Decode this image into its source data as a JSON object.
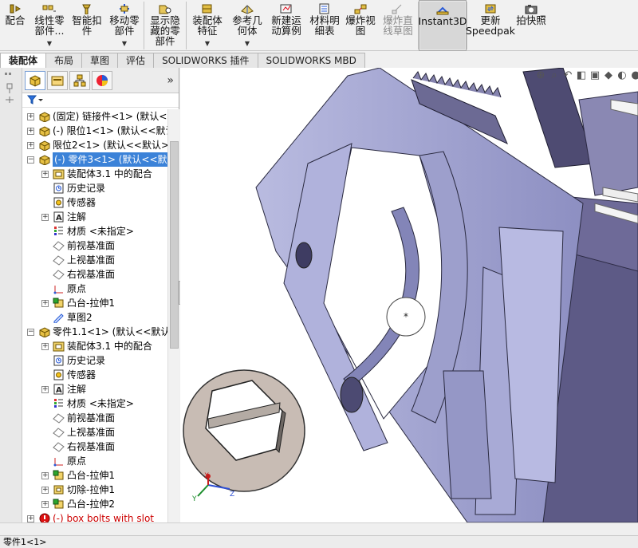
{
  "toolbar": {
    "items": [
      {
        "label": "配合",
        "icon": "mate-icon",
        "dropdown": false,
        "disabled": false
      },
      {
        "label": "线性零\n部件...",
        "icon": "linear-pattern-icon",
        "dropdown": true,
        "disabled": false
      },
      {
        "label": "智能扣\n件",
        "icon": "smart-fasteners-icon",
        "dropdown": false,
        "disabled": false
      },
      {
        "label": "移动零\n部件",
        "icon": "move-component-icon",
        "dropdown": true,
        "disabled": false
      },
      {
        "label": "显示隐\n藏的零\n部件",
        "icon": "show-hidden-icon",
        "dropdown": false,
        "disabled": false
      },
      {
        "label": "装配体\n特征",
        "icon": "assembly-features-icon",
        "dropdown": true,
        "disabled": false
      },
      {
        "label": "参考几\n何体",
        "icon": "reference-geometry-icon",
        "dropdown": true,
        "disabled": false
      },
      {
        "label": "新建运\n动算例",
        "icon": "new-motion-study-icon",
        "dropdown": false,
        "disabled": false
      },
      {
        "label": "材料明\n细表",
        "icon": "bom-icon",
        "dropdown": false,
        "disabled": false
      },
      {
        "label": "爆炸视\n图",
        "icon": "exploded-view-icon",
        "dropdown": false,
        "disabled": false
      },
      {
        "label": "爆炸直\n线草图",
        "icon": "explode-line-sketch-icon",
        "dropdown": false,
        "disabled": true
      },
      {
        "label": "Instant3D",
        "icon": "instant3d-icon",
        "dropdown": false,
        "disabled": false,
        "active": true
      },
      {
        "label": "更新\nSpeedpak",
        "icon": "speedpak-icon",
        "dropdown": false,
        "disabled": false
      },
      {
        "label": "拍快照",
        "icon": "snapshot-icon",
        "dropdown": false,
        "disabled": false
      }
    ]
  },
  "tabs": [
    {
      "label": "装配体",
      "active": true
    },
    {
      "label": "布局",
      "active": false
    },
    {
      "label": "草图",
      "active": false
    },
    {
      "label": "评估",
      "active": false
    },
    {
      "label": "SOLIDWORKS 插件",
      "active": false
    },
    {
      "label": "SOLIDWORKS MBD",
      "active": false
    }
  ],
  "tree": {
    "rows": [
      {
        "level": 0,
        "expander": "+",
        "icon": "part-icon",
        "text": "(固定) 链接件<1> (默认<<默",
        "selected": false
      },
      {
        "level": 0,
        "expander": "+",
        "icon": "part-icon",
        "text": "(-) 限位1<1> (默认<<默认",
        "selected": false
      },
      {
        "level": 0,
        "expander": "+",
        "icon": "part-icon",
        "text": "限位2<1> (默认<<默认>",
        "selected": false
      },
      {
        "level": 0,
        "expander": "−",
        "icon": "part-icon",
        "text": "(-) 零件3<1> (默认<<默认",
        "selected": true
      },
      {
        "level": 1,
        "expander": "+",
        "icon": "mates-folder-icon",
        "text": "装配体3.1 中的配合",
        "selected": false
      },
      {
        "level": 1,
        "expander": "",
        "icon": "history-icon",
        "text": "历史记录",
        "selected": false
      },
      {
        "level": 1,
        "expander": "",
        "icon": "sensor-icon",
        "text": "传感器",
        "selected": false
      },
      {
        "level": 1,
        "expander": "+",
        "icon": "annotation-icon",
        "text": "注解",
        "selected": false
      },
      {
        "level": 1,
        "expander": "",
        "icon": "material-icon",
        "text": "材质 <未指定>",
        "selected": false
      },
      {
        "level": 1,
        "expander": "",
        "icon": "plane-icon",
        "text": "前视基准面",
        "selected": false
      },
      {
        "level": 1,
        "expander": "",
        "icon": "plane-icon",
        "text": "上视基准面",
        "selected": false
      },
      {
        "level": 1,
        "expander": "",
        "icon": "plane-icon",
        "text": "右视基准面",
        "selected": false
      },
      {
        "level": 1,
        "expander": "",
        "icon": "origin-icon",
        "text": "原点",
        "selected": false
      },
      {
        "level": 1,
        "expander": "+",
        "icon": "boss-extrude-icon",
        "text": "凸台-拉伸1",
        "selected": false
      },
      {
        "level": 1,
        "expander": "",
        "icon": "sketch-icon",
        "text": "草图2",
        "selected": false
      },
      {
        "level": 0,
        "expander": "−",
        "icon": "part-icon",
        "text": "零件1.1<1> (默认<<默认",
        "selected": false
      },
      {
        "level": 1,
        "expander": "+",
        "icon": "mates-folder-icon",
        "text": "装配体3.1 中的配合",
        "selected": false
      },
      {
        "level": 1,
        "expander": "",
        "icon": "history-icon",
        "text": "历史记录",
        "selected": false
      },
      {
        "level": 1,
        "expander": "",
        "icon": "sensor-icon",
        "text": "传感器",
        "selected": false
      },
      {
        "level": 1,
        "expander": "+",
        "icon": "annotation-icon",
        "text": "注解",
        "selected": false
      },
      {
        "level": 1,
        "expander": "",
        "icon": "material-icon",
        "text": "材质 <未指定>",
        "selected": false
      },
      {
        "level": 1,
        "expander": "",
        "icon": "plane-icon",
        "text": "前视基准面",
        "selected": false
      },
      {
        "level": 1,
        "expander": "",
        "icon": "plane-icon",
        "text": "上视基准面",
        "selected": false
      },
      {
        "level": 1,
        "expander": "",
        "icon": "plane-icon",
        "text": "右视基准面",
        "selected": false
      },
      {
        "level": 1,
        "expander": "",
        "icon": "origin-icon",
        "text": "原点",
        "selected": false
      },
      {
        "level": 1,
        "expander": "+",
        "icon": "boss-extrude-icon",
        "text": "凸台-拉伸1",
        "selected": false
      },
      {
        "level": 1,
        "expander": "+",
        "icon": "cut-extrude-icon",
        "text": "切除-拉伸1",
        "selected": false
      },
      {
        "level": 1,
        "expander": "+",
        "icon": "boss-extrude-icon",
        "text": "凸台-拉伸2",
        "selected": false
      },
      {
        "level": 0,
        "expander": "+",
        "icon": "error-part-icon",
        "text": "(-) box bolts with slot",
        "selected": false,
        "error": true
      }
    ]
  },
  "triad": {
    "x": "X",
    "y": "Y",
    "z": "Z"
  },
  "status": {
    "text": "零件1<1>"
  },
  "colors": {
    "selection": "#3b82d8",
    "part_face": "#a7a9d6",
    "part_dark": "#5c5a86",
    "callout": "#c8bcb4"
  }
}
